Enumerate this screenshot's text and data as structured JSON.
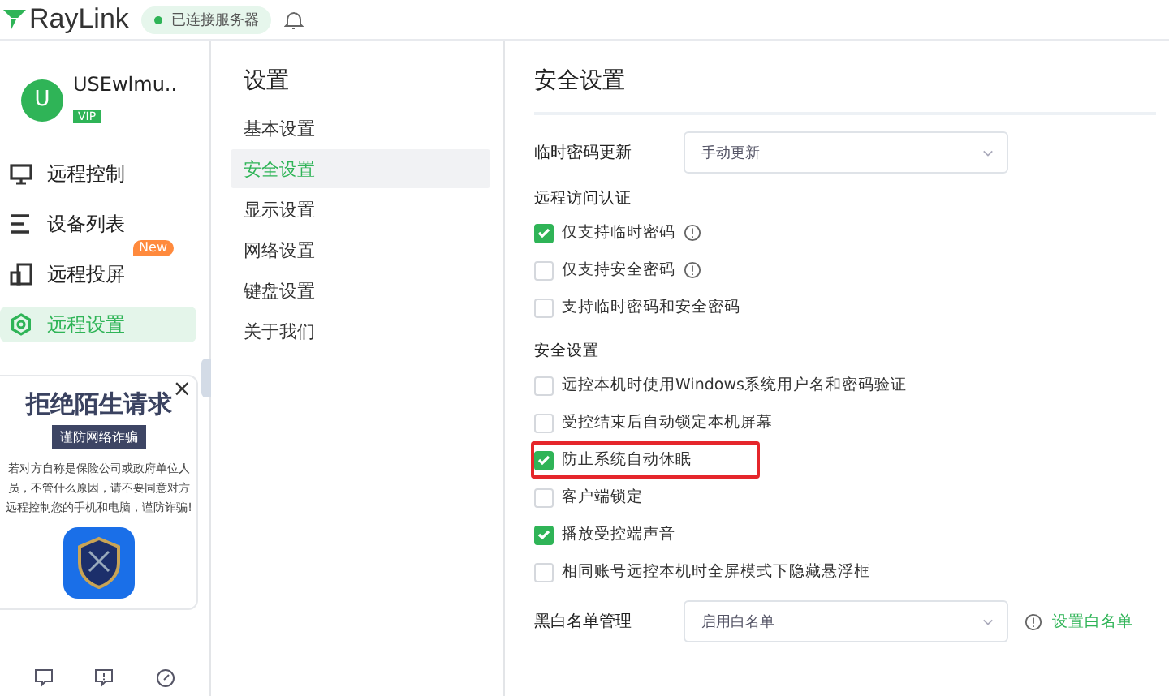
{
  "topbar": {
    "logo": "RayLink",
    "status": "已连接服务器"
  },
  "user": {
    "avatar": "U",
    "name": "USEwlmu..",
    "badge": "VIP"
  },
  "nav": [
    {
      "label": "远程控制",
      "selected": false
    },
    {
      "label": "设备列表",
      "selected": false
    },
    {
      "label": "远程投屏",
      "selected": false,
      "badge": "New"
    },
    {
      "label": "远程设置",
      "selected": true
    }
  ],
  "ad": {
    "title": "拒绝陌生请求",
    "subtitle": "谨防网络诈骗",
    "body": "若对方自称是保险公司或政府单位人员，不管什么原因，请不要同意对方远程控制您的手机和电脑，谨防诈骗!",
    "close": "×"
  },
  "settings_nav": {
    "title": "设置",
    "items": [
      {
        "label": "基本设置",
        "selected": false
      },
      {
        "label": "安全设置",
        "selected": true
      },
      {
        "label": "显示设置",
        "selected": false
      },
      {
        "label": "网络设置",
        "selected": false
      },
      {
        "label": "键盘设置",
        "selected": false
      },
      {
        "label": "关于我们",
        "selected": false
      }
    ]
  },
  "content": {
    "title": "安全设置",
    "password_update": {
      "label": "临时密码更新",
      "value": "手动更新"
    },
    "sections": [
      {
        "title": "远程访问认证",
        "options": [
          {
            "label": "仅支持临时密码",
            "checked": true,
            "info": true,
            "highlighted": false
          },
          {
            "label": "仅支持安全密码",
            "checked": false,
            "info": true,
            "highlighted": false
          },
          {
            "label": "支持临时密码和安全密码",
            "checked": false,
            "info": false,
            "highlighted": false
          }
        ]
      },
      {
        "title": "安全设置",
        "options": [
          {
            "label": "远控本机时使用Windows系统用户名和密码验证",
            "checked": false,
            "info": false,
            "highlighted": false
          },
          {
            "label": "受控结束后自动锁定本机屏幕",
            "checked": false,
            "info": false,
            "highlighted": false
          },
          {
            "label": "防止系统自动休眠",
            "checked": true,
            "info": false,
            "highlighted": true
          },
          {
            "label": "客户端锁定",
            "checked": false,
            "info": false,
            "highlighted": false
          },
          {
            "label": "播放受控端声音",
            "checked": true,
            "info": false,
            "highlighted": false
          },
          {
            "label": "相同账号远控本机时全屏模式下隐藏悬浮框",
            "checked": false,
            "info": false,
            "highlighted": false
          }
        ]
      }
    ],
    "whitelist": {
      "label": "黑白名单管理",
      "value": "启用白名单",
      "link": "设置白名单"
    }
  }
}
